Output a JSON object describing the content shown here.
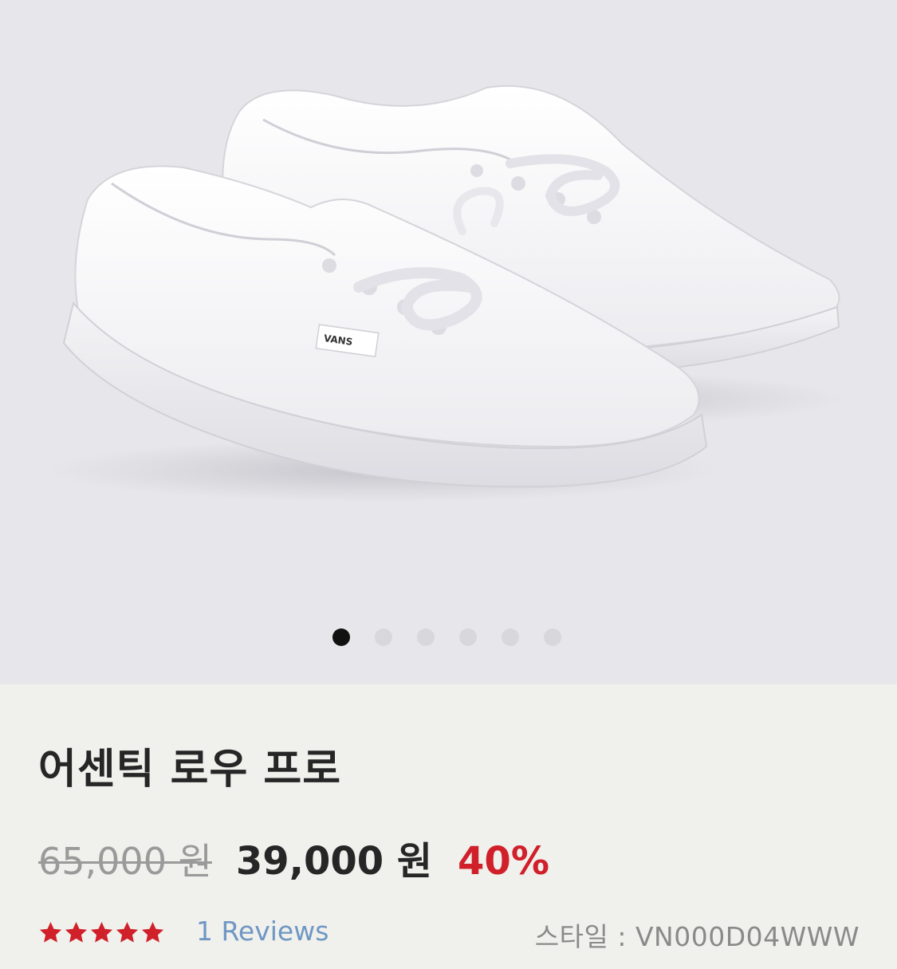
{
  "product": {
    "title": "어센틱 로우 프로",
    "image_alt": "white canvas low-top sneakers",
    "logo_text": "VANS",
    "carousel": {
      "count": 6,
      "active": 0
    },
    "original_price": "65,000 원",
    "sale_price": "39,000 원",
    "discount": "40%",
    "rating": 5,
    "reviews": "1 Reviews",
    "style_code": "스타일 : VN000D04WWW"
  },
  "colors": {
    "hero_bg": "#e7e7eb",
    "info_bg": "#f0f0ec",
    "discount": "#d0202a",
    "star": "#d0202a",
    "link": "#6e97c4"
  }
}
